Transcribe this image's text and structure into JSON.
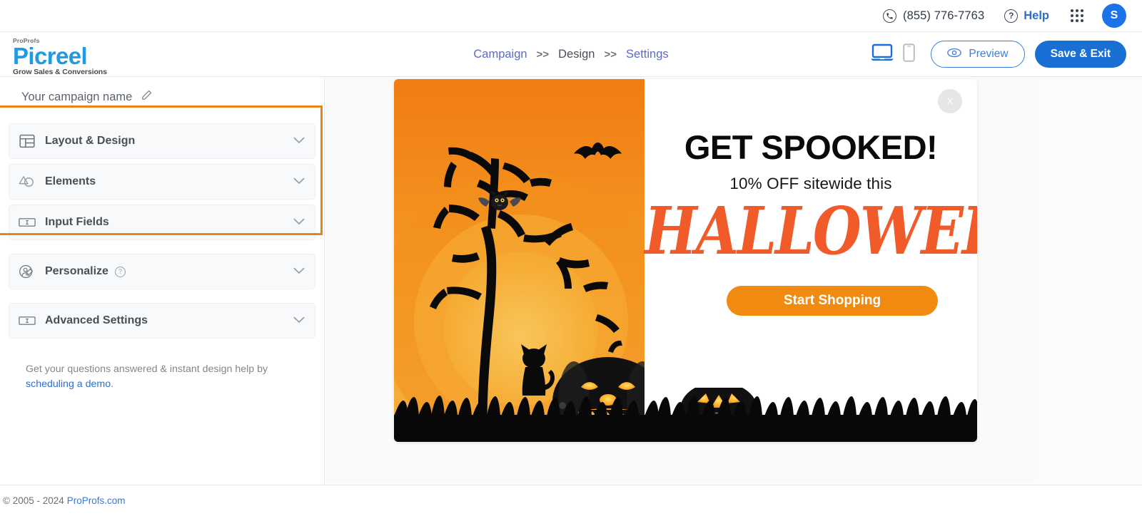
{
  "utility_bar": {
    "phone": "(855) 776-7763",
    "phone_icon": "phone-icon",
    "help_label": "Help",
    "help_icon": "question-circle-icon",
    "apps_icon": "apps-grid-icon",
    "avatar_initial": "S"
  },
  "brand": {
    "pretitle": "ProProfs",
    "name": "Picreel",
    "tagline": "Grow Sales & Conversions"
  },
  "breadcrumb": {
    "items": [
      {
        "label": "Campaign",
        "state": "link"
      },
      {
        "label": "Design",
        "state": "current"
      },
      {
        "label": "Settings",
        "state": "link"
      }
    ],
    "separator": ">>"
  },
  "header_actions": {
    "desktop_icon": "desktop-icon",
    "mobile_icon": "mobile-icon",
    "preview_label": "Preview",
    "preview_icon": "eye-icon",
    "save_label": "Save & Exit"
  },
  "sidebar": {
    "campaign_name": "Your campaign name",
    "edit_icon": "pencil-icon",
    "panels": [
      {
        "label": "Layout & Design",
        "icon": "layout-grid-icon",
        "chevron": "chevron-down-icon",
        "help": false
      },
      {
        "label": "Elements",
        "icon": "shapes-icon",
        "chevron": "chevron-down-icon",
        "help": false
      },
      {
        "label": "Input Fields",
        "icon": "input-field-icon",
        "chevron": "chevron-down-icon",
        "help": false
      },
      {
        "label": "Personalize",
        "icon": "person-edit-icon",
        "chevron": "chevron-down-icon",
        "help": true
      },
      {
        "label": "Advanced Settings",
        "icon": "input-field-icon",
        "chevron": "chevron-down-icon",
        "help": false
      }
    ],
    "help_text": "Get your questions answered & instant design help by",
    "help_link": "scheduling a demo",
    "help_period": "."
  },
  "popup": {
    "close_label": "X",
    "headline": "GET SPOOKED!",
    "subline": "10% OFF sitewide this",
    "script_word": "HALLOWEEN",
    "cta_label": "Start Shopping",
    "image_alt": "halloween-night-scene"
  },
  "footer": {
    "copyright": "© 2005 - 2024",
    "link": "ProProfs.com"
  },
  "colors": {
    "brand_blue": "#1e9ae6",
    "action_blue": "#1a6fd4",
    "highlight_orange": "#eb8417",
    "cta_orange": "#f18a10",
    "script_orange": "#f15a29"
  }
}
